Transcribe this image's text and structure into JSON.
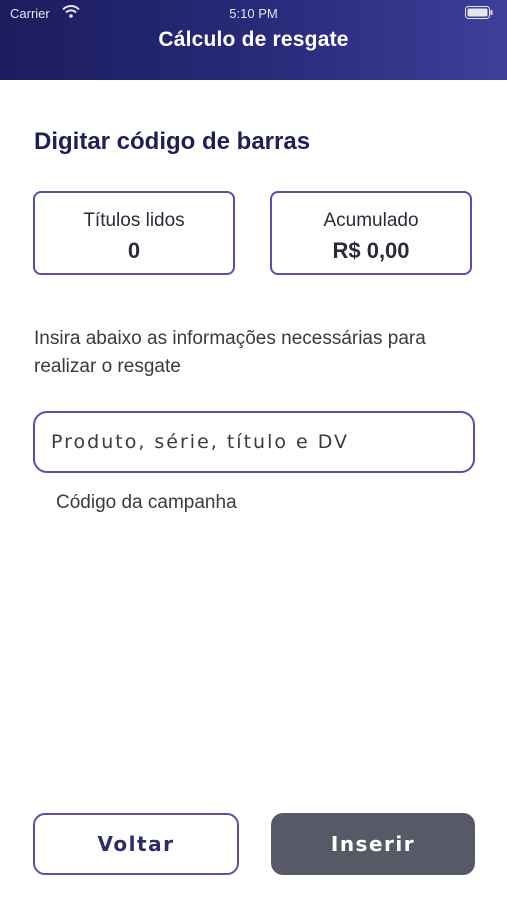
{
  "status_bar": {
    "carrier": "Carrier",
    "time": "5:10 PM",
    "icons": [
      "wifi-icon",
      "battery-icon"
    ]
  },
  "header": {
    "title": "Cálculo de resgate",
    "gradient": [
      "#1c1c5e",
      "#3e3f9a"
    ]
  },
  "main": {
    "section_title": "Digitar código de barras",
    "cards": {
      "read_titles": {
        "label": "Títulos lidos",
        "value": "0"
      },
      "accumulated": {
        "label": "Acumulado",
        "value": "R$ 0,00"
      }
    },
    "instructions": "Insira abaixo as informações necessárias para realizar o resgate",
    "barcode_input": {
      "placeholder": "Produto, série, título e DV",
      "value": ""
    },
    "campaign_code_label": "Código da campanha"
  },
  "actions": {
    "back_label": "Voltar",
    "insert_label": "Inserir"
  },
  "colors": {
    "accent_border": "#5152b0",
    "title_text": "#1e1e5a",
    "insert_button": "#575a66"
  }
}
